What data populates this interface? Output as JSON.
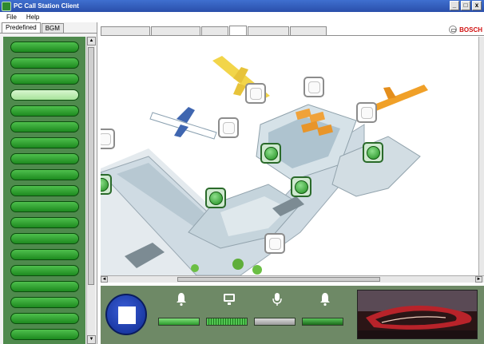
{
  "window": {
    "title": "PC Call Station Client",
    "controls": [
      "_",
      "□",
      "x"
    ]
  },
  "menu": [
    {
      "label": "File"
    },
    {
      "label": "Help"
    }
  ],
  "left_panel": {
    "tabs": [
      {
        "label": "Predefined",
        "active": true
      },
      {
        "label": "BGM",
        "active": false
      }
    ],
    "zones": [
      {
        "label": "",
        "selected": false
      },
      {
        "label": "",
        "selected": false
      },
      {
        "label": "",
        "selected": false
      },
      {
        "label": "",
        "selected": true
      },
      {
        "label": "",
        "selected": false
      },
      {
        "label": "",
        "selected": false
      },
      {
        "label": "",
        "selected": false
      },
      {
        "label": "",
        "selected": false
      },
      {
        "label": "",
        "selected": false
      },
      {
        "label": "",
        "selected": false
      },
      {
        "label": "",
        "selected": false
      },
      {
        "label": "",
        "selected": false
      },
      {
        "label": "",
        "selected": false
      },
      {
        "label": "",
        "selected": false
      },
      {
        "label": "",
        "selected": false
      },
      {
        "label": "",
        "selected": false
      },
      {
        "label": "",
        "selected": false
      },
      {
        "label": "",
        "selected": false
      },
      {
        "label": "",
        "selected": false
      }
    ],
    "scroll_up": "▲",
    "scroll_down": "▼"
  },
  "map_tabs": [
    {
      "label": "",
      "active": false
    },
    {
      "label": "",
      "active": false
    },
    {
      "label": "",
      "active": false
    },
    {
      "label": "",
      "active": true
    },
    {
      "label": "",
      "active": false
    },
    {
      "label": "",
      "active": false
    }
  ],
  "brand": {
    "name": "BOSCH",
    "color": "#d11212"
  },
  "map": {
    "scroll_left": "◄",
    "scroll_right": "►",
    "nodes": [
      {
        "label": "",
        "state": "idle"
      },
      {
        "label": "",
        "state": "idle"
      },
      {
        "label": "",
        "state": "idle"
      },
      {
        "label": "",
        "state": "idle"
      },
      {
        "label": "",
        "state": "active"
      },
      {
        "label": "",
        "state": "active"
      },
      {
        "label": "",
        "state": "active"
      },
      {
        "label": "",
        "state": "active"
      },
      {
        "label": "",
        "state": "idle"
      },
      {
        "label": "",
        "state": "idle"
      },
      {
        "label": "",
        "state": "active"
      }
    ]
  },
  "controls": {
    "stop": {
      "icon": "stop-square-icon"
    },
    "channels": [
      {
        "icon": "bell-icon",
        "level_style": "bright"
      },
      {
        "icon": "monitor-icon",
        "level_style": "segmented"
      },
      {
        "icon": "microphone-icon",
        "level_style": "grey"
      },
      {
        "icon": "bell-icon",
        "level_style": "dark"
      }
    ]
  },
  "colors": {
    "titlebar": "#2a4faa",
    "zone_button": "#1d8a1f",
    "zone_button_selected": "#a7e39a",
    "control_bar": "#6e8966",
    "stop_button": "#0d2a8f",
    "brand_red": "#d11212"
  }
}
